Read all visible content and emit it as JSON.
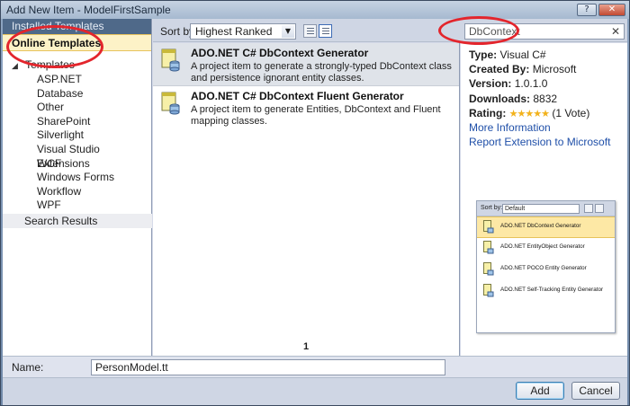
{
  "window": {
    "title": "Add New Item - ModelFirstSample"
  },
  "titlebar": {
    "help_icon": "?",
    "close_icon": "✕"
  },
  "sidebar": {
    "installed_label": "Installed Templates",
    "online_label": "Online Templates",
    "templates_label": "Templates",
    "templates_arrow": "◢",
    "items": [
      "ASP.NET",
      "Database",
      "Other",
      "SharePoint",
      "Silverlight",
      "Visual Studio Extensions",
      "WCF",
      "Windows Forms",
      "Workflow",
      "WPF"
    ],
    "search_results_label": "Search Results"
  },
  "toolbar": {
    "sort_label": "Sort by:",
    "sort_value": "Highest Ranked",
    "dropdown_icon": "▼",
    "search_value": "DbContext",
    "search_clear_icon": "✕"
  },
  "templates": [
    {
      "title": "ADO.NET C# DbContext Generator",
      "description": "A project item to generate a strongly-typed DbContext class and persistence ignorant entity classes."
    },
    {
      "title": "ADO.NET C# DbContext Fluent Generator",
      "description": "A project item to generate Entities, DbContext and Fluent mapping classes."
    }
  ],
  "pager": {
    "page": "1"
  },
  "details": {
    "type_label": "Type:",
    "type_value": "Visual C#",
    "created_label": "Created By:",
    "created_value": "Microsoft",
    "version_label": "Version:",
    "version_value": "1.0.1.0",
    "downloads_label": "Downloads:",
    "downloads_value": "8832",
    "rating_label": "Rating:",
    "rating_stars": "★★★★★",
    "rating_votes": "(1 Vote)",
    "more_info_link": "More Information",
    "report_link": "Report Extension to Microsoft"
  },
  "preview": {
    "sort_label": "Sort by:",
    "sort_value": "Default",
    "items": [
      "ADO.NET DbContext Generator",
      "ADO.NET EntityObject Generator",
      "ADO.NET POCO Entity Generator",
      "ADO.NET Self-Tracking Entity Generator"
    ]
  },
  "footer": {
    "name_label": "Name:",
    "name_value": "PersonModel.tt",
    "add_label": "Add",
    "cancel_label": "Cancel"
  },
  "colors": {
    "annotation": "#e3252c",
    "selected": "#fdf2c7",
    "link": "#1f4fa8",
    "header": "#4f6989"
  }
}
